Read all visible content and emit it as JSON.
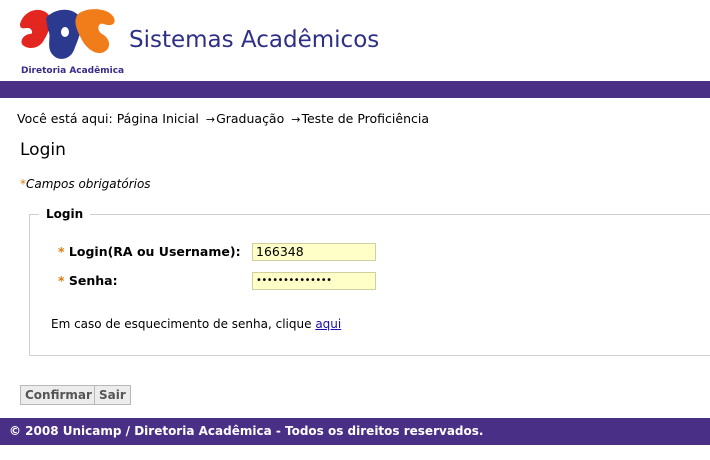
{
  "header": {
    "logo_caption": "Diretoria Acadêmica",
    "site_title": "Sistemas Acadêmicos"
  },
  "breadcrumb": {
    "prefix": "Você está aqui:",
    "items": [
      "Página Inicial",
      "Graduação",
      "Teste de Proficiência"
    ],
    "separator": "→"
  },
  "page_title": "Login",
  "required_note": {
    "star": "*",
    "text": "Campos obrigatórios"
  },
  "form": {
    "legend": "Login",
    "fields": [
      {
        "star": "*",
        "label": "Login(RA ou Username):",
        "value": "166348"
      },
      {
        "star": "*",
        "label": "Senha:",
        "value": "••••••••••••••"
      }
    ],
    "forgot_text": "Em caso de esquecimento de senha, clique",
    "forgot_link": "aqui"
  },
  "buttons": {
    "confirm": "Confirmar",
    "exit": "Sair"
  },
  "footer": "© 2008 Unicamp / Diretoria Acadêmica - Todos os direitos reservados.",
  "colors": {
    "brand_purple": "#4a2f87",
    "title_blue": "#2e2f86",
    "required_orange": "#e07a10",
    "input_yellow": "#ffffc8"
  }
}
